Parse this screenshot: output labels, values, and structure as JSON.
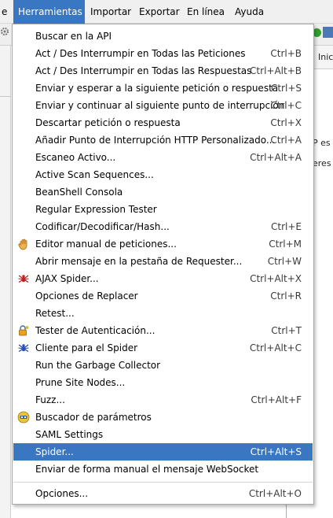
{
  "menubar": {
    "items": [
      {
        "label": "e"
      },
      {
        "label": "Herramientas"
      },
      {
        "label": "Importar"
      },
      {
        "label": "Exportar"
      },
      {
        "label": "En línea"
      },
      {
        "label": "Ayuda"
      }
    ],
    "active_index": 1
  },
  "background": {
    "tab_label": "Inic",
    "text1": "P es",
    "text2": "eres"
  },
  "menu": {
    "items": [
      {
        "label": "Buscar en la API",
        "shortcut": "",
        "icon": ""
      },
      {
        "label": "Act / Des Interrumpir en Todas las Peticiones",
        "shortcut": "Ctrl+B",
        "icon": ""
      },
      {
        "label": "Act / Des Interrumpir en Todas las Respuestas",
        "shortcut": "Ctrl+Alt+B",
        "icon": ""
      },
      {
        "label": "Enviar y esperar a la siguiente petición o respuesta",
        "shortcut": "Ctrl+S",
        "icon": ""
      },
      {
        "label": "Enviar y continuar al siguiente punto de interrupción",
        "shortcut": "Ctrl+C",
        "icon": ""
      },
      {
        "label": "Descartar petición o respuesta",
        "shortcut": "Ctrl+X",
        "icon": ""
      },
      {
        "label": "Añadir Punto de Interrupción HTTP Personalizado...",
        "shortcut": "Ctrl+A",
        "icon": ""
      },
      {
        "label": "Escaneo Activo...",
        "shortcut": "Ctrl+Alt+A",
        "icon": ""
      },
      {
        "label": "Active Scan Sequences...",
        "shortcut": "",
        "icon": ""
      },
      {
        "label": "BeanShell Consola",
        "shortcut": "",
        "icon": ""
      },
      {
        "label": "Regular Expression Tester",
        "shortcut": "",
        "icon": ""
      },
      {
        "label": "Codificar/Decodificar/Hash...",
        "shortcut": "Ctrl+E",
        "icon": ""
      },
      {
        "label": "Editor manual de peticiones...",
        "shortcut": "Ctrl+M",
        "icon": "hand-icon"
      },
      {
        "label": "Abrir mensaje en la pestaña de Requester...",
        "shortcut": "Ctrl+W",
        "icon": ""
      },
      {
        "label": "AJAX Spider...",
        "shortcut": "Ctrl+Alt+X",
        "icon": "red-spider-icon"
      },
      {
        "label": "Opciones de Replacer",
        "shortcut": "Ctrl+R",
        "icon": ""
      },
      {
        "label": "Retest...",
        "shortcut": "",
        "icon": ""
      },
      {
        "label": "Tester de Autenticación...",
        "shortcut": "Ctrl+T",
        "icon": "lock-key-icon"
      },
      {
        "label": "Cliente para el Spider",
        "shortcut": "Ctrl+Alt+C",
        "icon": "blue-spider-icon"
      },
      {
        "label": "Run the Garbage Collector",
        "shortcut": "",
        "icon": ""
      },
      {
        "label": "Prune Site Nodes...",
        "shortcut": "",
        "icon": ""
      },
      {
        "label": "Fuzz...",
        "shortcut": "Ctrl+Alt+F",
        "icon": ""
      },
      {
        "label": "Buscador de parámetros",
        "shortcut": "",
        "icon": "param-finder-icon"
      },
      {
        "label": "SAML Settings",
        "shortcut": "",
        "icon": ""
      },
      {
        "label": "Spider...",
        "shortcut": "Ctrl+Alt+S",
        "icon": ""
      },
      {
        "label": "Enviar de forma manual el mensaje WebSocket",
        "shortcut": "",
        "icon": ""
      },
      {
        "label": "Opciones...",
        "shortcut": "Ctrl+Alt+O",
        "icon": ""
      }
    ],
    "highlighted_index": 24
  },
  "colors": {
    "highlight": "#3a77c2",
    "menubar_bg": "#f0f0f0"
  }
}
